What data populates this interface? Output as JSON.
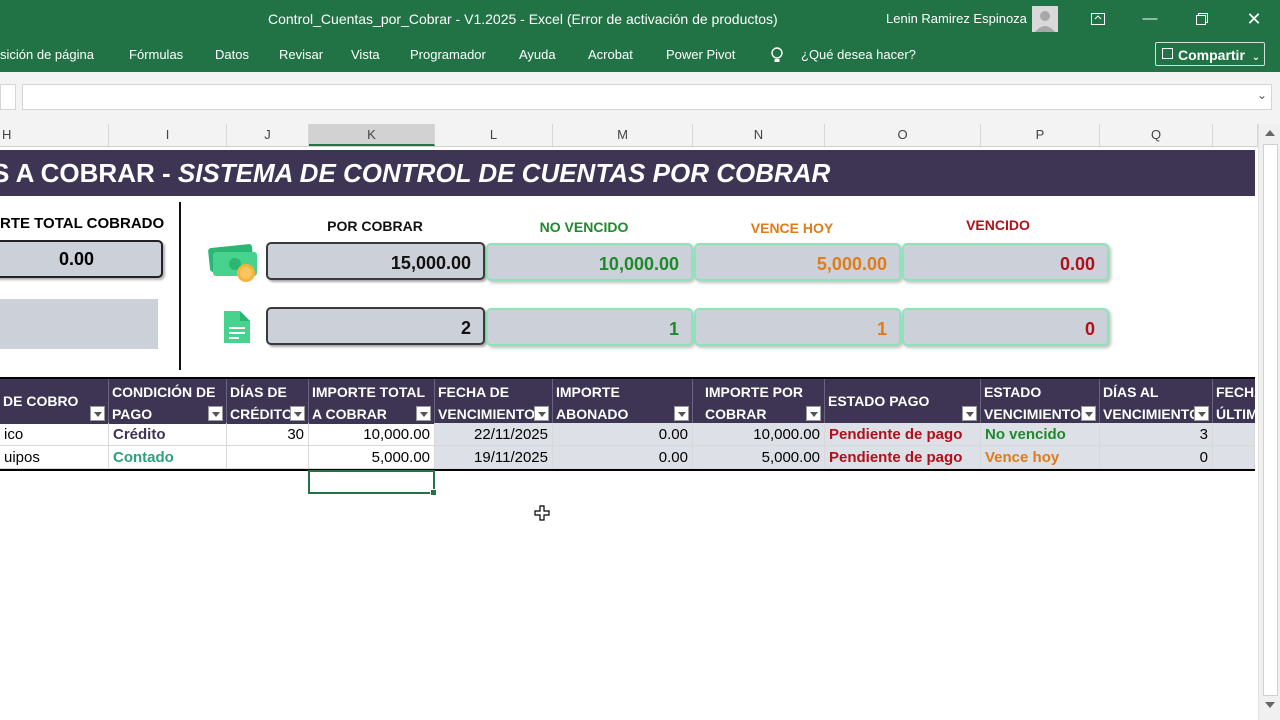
{
  "window": {
    "title": "Control_Cuentas_por_Cobrar - V1.2025  -  Excel (Error de activación de productos)",
    "user": "Lenin Ramirez Espinoza"
  },
  "ribbon": {
    "tabs": [
      "sición de página",
      "Fórmulas",
      "Datos",
      "Revisar",
      "Vista",
      "Programador",
      "Ayuda",
      "Acrobat",
      "Power Pivot"
    ],
    "tell_me": "¿Qué desea hacer?",
    "share": "Compartir"
  },
  "columns": [
    "H",
    "I",
    "J",
    "K",
    "L",
    "M",
    "N",
    "O",
    "P",
    "Q"
  ],
  "banner": {
    "prefix": "S A COBRAR - ",
    "italic": "SISTEMA DE CONTROL DE CUENTAS POR COBRAR"
  },
  "summary": {
    "total_cobrado_label": "RTE TOTAL COBRADO",
    "total_cobrado_value": "0.00",
    "por_cobrar_label": "POR COBRAR",
    "no_vencido_label": "NO VENCIDO",
    "vence_hoy_label": "VENCE HOY",
    "vencido_label": "VENCIDO",
    "amounts": {
      "por_cobrar": "15,000.00",
      "no_vencido": "10,000.00",
      "vence_hoy": "5,000.00",
      "vencido": "0.00"
    },
    "counts": {
      "por_cobrar": "2",
      "no_vencido": "1",
      "vence_hoy": "1",
      "vencido": "0"
    }
  },
  "table": {
    "headers": [
      "DE COBRO",
      "CONDICIÓN DE\nPAGO",
      "DÍAS DE\nCRÉDITO",
      "IMPORTE TOTAL\nA COBRAR",
      "FECHA DE\nVENCIMIENTO",
      "IMPORTE\nABONADO",
      "IMPORTE POR\nCOBRAR",
      "ESTADO PAGO",
      "ESTADO\nVENCIMIENTO",
      "DÍAS AL\nVENCIMIENTO",
      "FECHA\nÚLTIM"
    ],
    "rows": [
      [
        "ico",
        "Crédito",
        "30",
        "10,000.00",
        "22/11/2025",
        "0.00",
        "10,000.00",
        "Pendiente de pago",
        "No vencido",
        "3",
        ""
      ],
      [
        "uipos",
        "Contado",
        "",
        "5,000.00",
        "19/11/2025",
        "0.00",
        "5,000.00",
        "Pendiente de pago",
        "Vence hoy",
        "0",
        ""
      ]
    ]
  },
  "colors": {
    "excel_green": "#217346",
    "header_purple": "#3d3553",
    "green_text": "#1e8a2e",
    "orange_text": "#e07b18",
    "red_text": "#b0101a",
    "teal_text": "#2aa37a"
  }
}
